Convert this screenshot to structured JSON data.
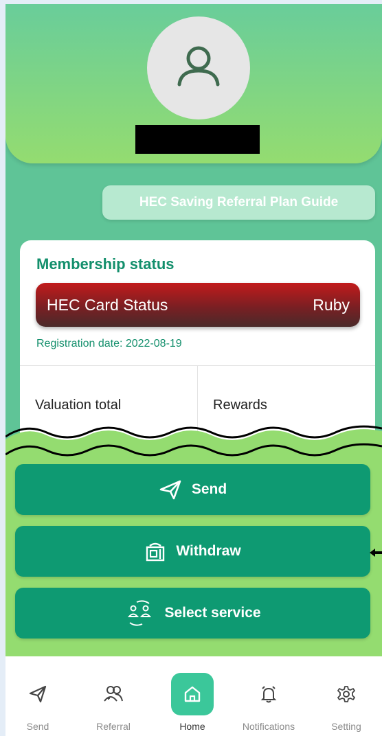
{
  "header": {
    "avatar_icon": "user-icon"
  },
  "guide_button": {
    "label": "HEC Saving Referral Plan Guide"
  },
  "membership": {
    "title": "Membership status",
    "card_status_label": "HEC Card Status",
    "card_status_value": "Ruby",
    "registration_date": "Registration date: 2022-08-19",
    "valuation_label": "Valuation total",
    "rewards_label": "Rewards"
  },
  "actions": [
    {
      "label": "Send",
      "icon": "send-icon"
    },
    {
      "label": "Withdraw",
      "icon": "withdraw-icon"
    },
    {
      "label": "Select service",
      "icon": "exchange-users-icon"
    }
  ],
  "nav": [
    {
      "label": "Send",
      "icon": "send-icon"
    },
    {
      "label": "Referral",
      "icon": "referral-icon"
    },
    {
      "label": "Home",
      "icon": "home-icon",
      "active": true
    },
    {
      "label": "Notifications",
      "icon": "bell-icon"
    },
    {
      "label": "Setting",
      "icon": "gear-icon"
    }
  ],
  "colors": {
    "primary": "#0e9a72",
    "accent_text": "#138f6c",
    "ruby": "#c21b1b",
    "nav_active": "#3bc79a"
  }
}
